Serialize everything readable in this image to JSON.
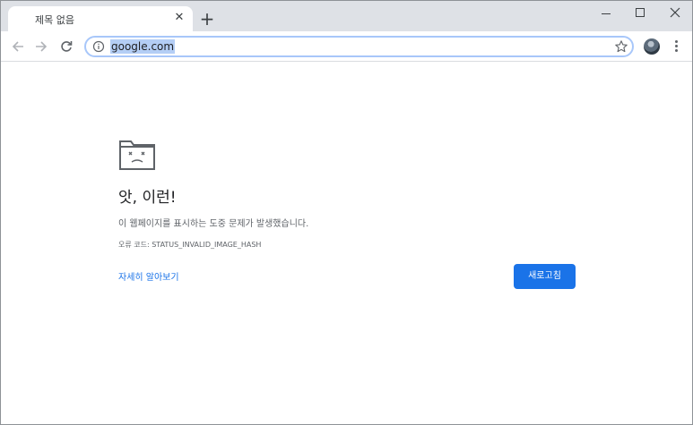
{
  "tab": {
    "title": "제목 없음",
    "close_glyph": "✕"
  },
  "new_tab_glyph": "+",
  "omnibox": {
    "url": "google.com"
  },
  "error": {
    "title": "앗, 이런!",
    "description": "이 웹페이지를 표시하는 도중 문제가 발생했습니다.",
    "code_line": "오류 코드: STATUS_INVALID_IMAGE_HASH",
    "learn_more": "자세히 알아보기",
    "reload_label": "새로고침"
  },
  "icons": {
    "back": "back-arrow-icon",
    "forward": "forward-arrow-icon",
    "reload": "reload-icon",
    "info": "info-icon",
    "bookmark": "star-icon",
    "menu": "kebab-menu-icon",
    "error_graphic": "sad-folder-icon"
  },
  "colors": {
    "tabstrip": "#dee1e6",
    "accent": "#1a73e8",
    "url_highlight": "#b4cef5",
    "omnibox_border": "#a8c7fa"
  }
}
